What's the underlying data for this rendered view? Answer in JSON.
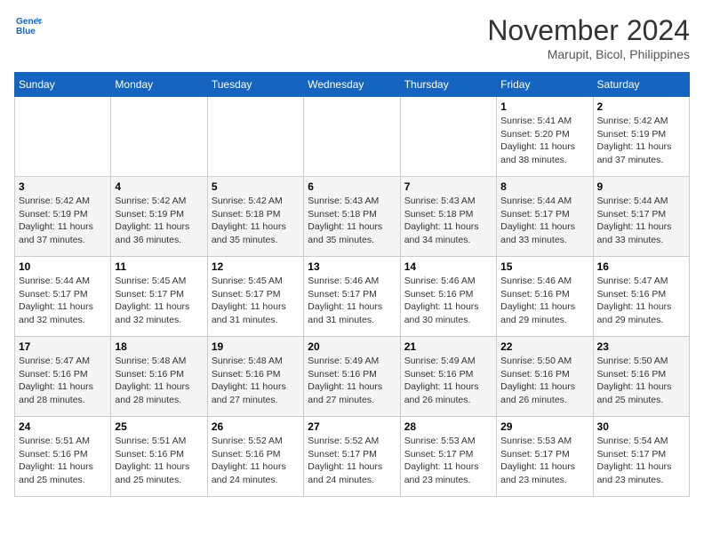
{
  "header": {
    "logo_line1": "General",
    "logo_line2": "Blue",
    "month": "November 2024",
    "location": "Marupit, Bicol, Philippines"
  },
  "weekdays": [
    "Sunday",
    "Monday",
    "Tuesday",
    "Wednesday",
    "Thursday",
    "Friday",
    "Saturday"
  ],
  "weeks": [
    [
      {
        "day": "",
        "info": ""
      },
      {
        "day": "",
        "info": ""
      },
      {
        "day": "",
        "info": ""
      },
      {
        "day": "",
        "info": ""
      },
      {
        "day": "",
        "info": ""
      },
      {
        "day": "1",
        "info": "Sunrise: 5:41 AM\nSunset: 5:20 PM\nDaylight: 11 hours\nand 38 minutes."
      },
      {
        "day": "2",
        "info": "Sunrise: 5:42 AM\nSunset: 5:19 PM\nDaylight: 11 hours\nand 37 minutes."
      }
    ],
    [
      {
        "day": "3",
        "info": "Sunrise: 5:42 AM\nSunset: 5:19 PM\nDaylight: 11 hours\nand 37 minutes."
      },
      {
        "day": "4",
        "info": "Sunrise: 5:42 AM\nSunset: 5:19 PM\nDaylight: 11 hours\nand 36 minutes."
      },
      {
        "day": "5",
        "info": "Sunrise: 5:42 AM\nSunset: 5:18 PM\nDaylight: 11 hours\nand 35 minutes."
      },
      {
        "day": "6",
        "info": "Sunrise: 5:43 AM\nSunset: 5:18 PM\nDaylight: 11 hours\nand 35 minutes."
      },
      {
        "day": "7",
        "info": "Sunrise: 5:43 AM\nSunset: 5:18 PM\nDaylight: 11 hours\nand 34 minutes."
      },
      {
        "day": "8",
        "info": "Sunrise: 5:44 AM\nSunset: 5:17 PM\nDaylight: 11 hours\nand 33 minutes."
      },
      {
        "day": "9",
        "info": "Sunrise: 5:44 AM\nSunset: 5:17 PM\nDaylight: 11 hours\nand 33 minutes."
      }
    ],
    [
      {
        "day": "10",
        "info": "Sunrise: 5:44 AM\nSunset: 5:17 PM\nDaylight: 11 hours\nand 32 minutes."
      },
      {
        "day": "11",
        "info": "Sunrise: 5:45 AM\nSunset: 5:17 PM\nDaylight: 11 hours\nand 32 minutes."
      },
      {
        "day": "12",
        "info": "Sunrise: 5:45 AM\nSunset: 5:17 PM\nDaylight: 11 hours\nand 31 minutes."
      },
      {
        "day": "13",
        "info": "Sunrise: 5:46 AM\nSunset: 5:17 PM\nDaylight: 11 hours\nand 31 minutes."
      },
      {
        "day": "14",
        "info": "Sunrise: 5:46 AM\nSunset: 5:16 PM\nDaylight: 11 hours\nand 30 minutes."
      },
      {
        "day": "15",
        "info": "Sunrise: 5:46 AM\nSunset: 5:16 PM\nDaylight: 11 hours\nand 29 minutes."
      },
      {
        "day": "16",
        "info": "Sunrise: 5:47 AM\nSunset: 5:16 PM\nDaylight: 11 hours\nand 29 minutes."
      }
    ],
    [
      {
        "day": "17",
        "info": "Sunrise: 5:47 AM\nSunset: 5:16 PM\nDaylight: 11 hours\nand 28 minutes."
      },
      {
        "day": "18",
        "info": "Sunrise: 5:48 AM\nSunset: 5:16 PM\nDaylight: 11 hours\nand 28 minutes."
      },
      {
        "day": "19",
        "info": "Sunrise: 5:48 AM\nSunset: 5:16 PM\nDaylight: 11 hours\nand 27 minutes."
      },
      {
        "day": "20",
        "info": "Sunrise: 5:49 AM\nSunset: 5:16 PM\nDaylight: 11 hours\nand 27 minutes."
      },
      {
        "day": "21",
        "info": "Sunrise: 5:49 AM\nSunset: 5:16 PM\nDaylight: 11 hours\nand 26 minutes."
      },
      {
        "day": "22",
        "info": "Sunrise: 5:50 AM\nSunset: 5:16 PM\nDaylight: 11 hours\nand 26 minutes."
      },
      {
        "day": "23",
        "info": "Sunrise: 5:50 AM\nSunset: 5:16 PM\nDaylight: 11 hours\nand 25 minutes."
      }
    ],
    [
      {
        "day": "24",
        "info": "Sunrise: 5:51 AM\nSunset: 5:16 PM\nDaylight: 11 hours\nand 25 minutes."
      },
      {
        "day": "25",
        "info": "Sunrise: 5:51 AM\nSunset: 5:16 PM\nDaylight: 11 hours\nand 25 minutes."
      },
      {
        "day": "26",
        "info": "Sunrise: 5:52 AM\nSunset: 5:16 PM\nDaylight: 11 hours\nand 24 minutes."
      },
      {
        "day": "27",
        "info": "Sunrise: 5:52 AM\nSunset: 5:17 PM\nDaylight: 11 hours\nand 24 minutes."
      },
      {
        "day": "28",
        "info": "Sunrise: 5:53 AM\nSunset: 5:17 PM\nDaylight: 11 hours\nand 23 minutes."
      },
      {
        "day": "29",
        "info": "Sunrise: 5:53 AM\nSunset: 5:17 PM\nDaylight: 11 hours\nand 23 minutes."
      },
      {
        "day": "30",
        "info": "Sunrise: 5:54 AM\nSunset: 5:17 PM\nDaylight: 11 hours\nand 23 minutes."
      }
    ]
  ]
}
